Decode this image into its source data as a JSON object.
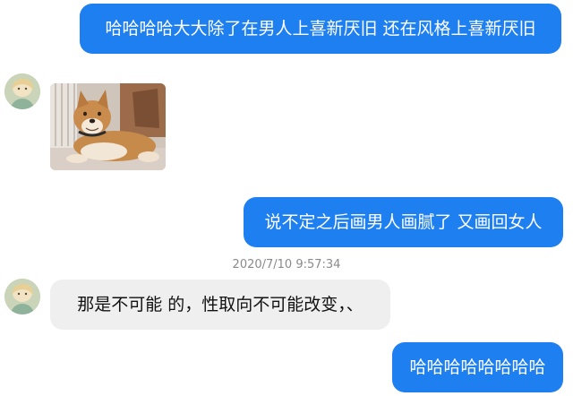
{
  "messages": [
    {
      "id": "m1",
      "side": "outgoing",
      "text": "哈哈哈哈大大除了在男人上喜新厌旧 还在风格上喜新厌旧"
    },
    {
      "id": "m2",
      "side": "incoming",
      "kind": "image",
      "image_subject": "shiba-inu-dog-photo"
    },
    {
      "id": "m3",
      "side": "outgoing",
      "text": "说不定之后画男人画腻了 又画回女人"
    },
    {
      "id": "m4",
      "side": "incoming",
      "text": "那是不可能 的，性取向不可能改变，、"
    },
    {
      "id": "m5",
      "side": "outgoing",
      "text": "哈哈哈哈哈哈哈哈"
    }
  ],
  "timestamp": "2020/7/10 9:57:34",
  "colors": {
    "outgoing_bubble": "#1e7ff0",
    "incoming_bubble": "#efefef",
    "timestamp_text": "#8a8a8a"
  }
}
